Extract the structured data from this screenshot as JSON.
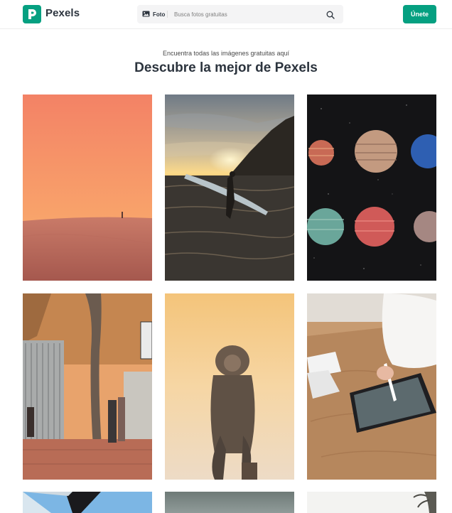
{
  "header": {
    "brand": "Pexels",
    "search": {
      "type_label": "Foto",
      "placeholder": "Busca fotos gratuitas"
    },
    "join_label": "Únete"
  },
  "hero": {
    "subtitle": "Encuentra todas las imágenes gratuitas aquí",
    "title": "Descubre la mejor de Pexels"
  },
  "colors": {
    "brand": "#05a081"
  },
  "photos": [
    {
      "subject": "desert-dunes-sunset"
    },
    {
      "subject": "surfer-sunset"
    },
    {
      "subject": "planets"
    },
    {
      "subject": "street-tree"
    },
    {
      "subject": "monkey-sunset"
    },
    {
      "subject": "tablet-drawing"
    },
    {
      "subject": "umbrella-sky"
    },
    {
      "subject": "gray-sky"
    },
    {
      "subject": "white-sky-plant"
    }
  ]
}
